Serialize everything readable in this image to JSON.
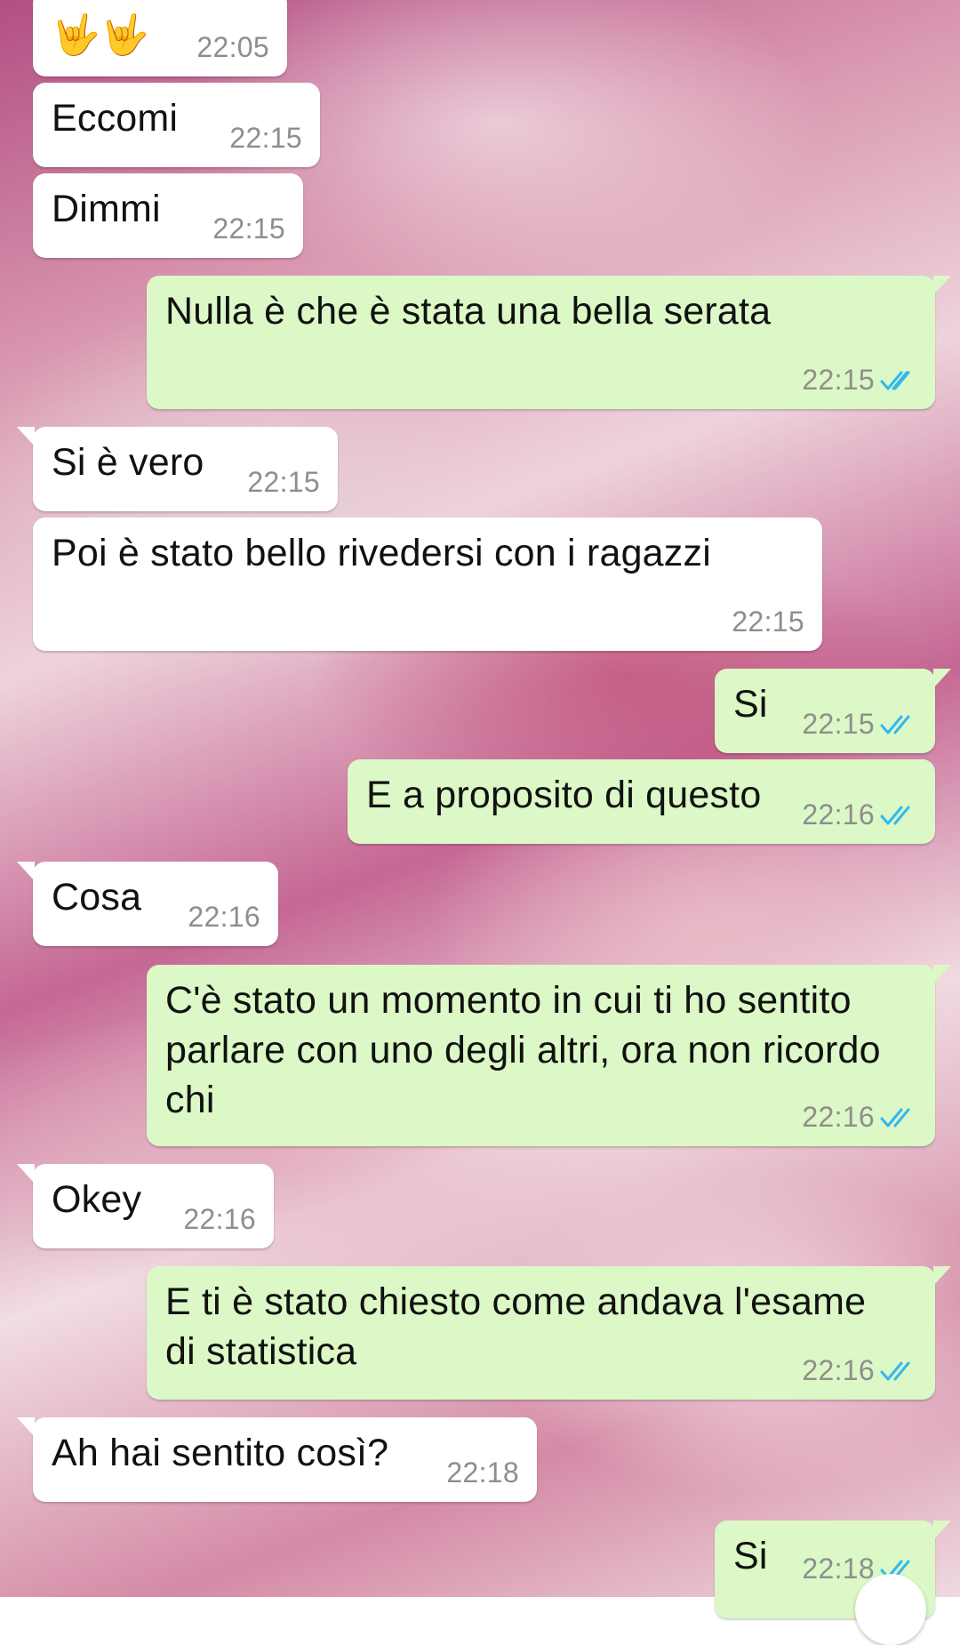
{
  "messages": [
    {
      "side": "in",
      "text": "🤟🤟",
      "time": "22:05"
    },
    {
      "side": "in",
      "text": "Eccomi",
      "time": "22:15"
    },
    {
      "side": "in",
      "text": "Dimmi",
      "time": "22:15"
    },
    {
      "side": "out",
      "text": "Nulla è che è stata una bella serata",
      "time": "22:15",
      "status": "read"
    },
    {
      "side": "in",
      "text": "Si è vero",
      "time": "22:15"
    },
    {
      "side": "in",
      "text": "Poi è stato bello rivedersi con i ragazzi",
      "time": "22:15"
    },
    {
      "side": "out",
      "text": "Si",
      "time": "22:15",
      "status": "read"
    },
    {
      "side": "out",
      "text": "E a proposito di questo",
      "time": "22:16",
      "status": "read"
    },
    {
      "side": "in",
      "text": "Cosa",
      "time": "22:16"
    },
    {
      "side": "out",
      "text": "C'è stato un momento in cui ti ho sentito\nparlare con uno degli altri, ora non ricordo\nchi",
      "time": "22:16",
      "status": "read"
    },
    {
      "side": "in",
      "text": "Okey",
      "time": "22:16"
    },
    {
      "side": "out",
      "text": "E ti è stato chiesto come andava l'esame\ndi statistica",
      "time": "22:16",
      "status": "read"
    },
    {
      "side": "in",
      "text": "Ah hai sentito così?",
      "time": "22:18"
    },
    {
      "side": "out",
      "text": "Si",
      "time": "22:18",
      "status": "read"
    }
  ],
  "colors": {
    "incoming": "#ffffff",
    "outgoing": "#dcf8c6",
    "read_ticks": "#34b7f1",
    "timestamp": "#8e8e8e"
  }
}
